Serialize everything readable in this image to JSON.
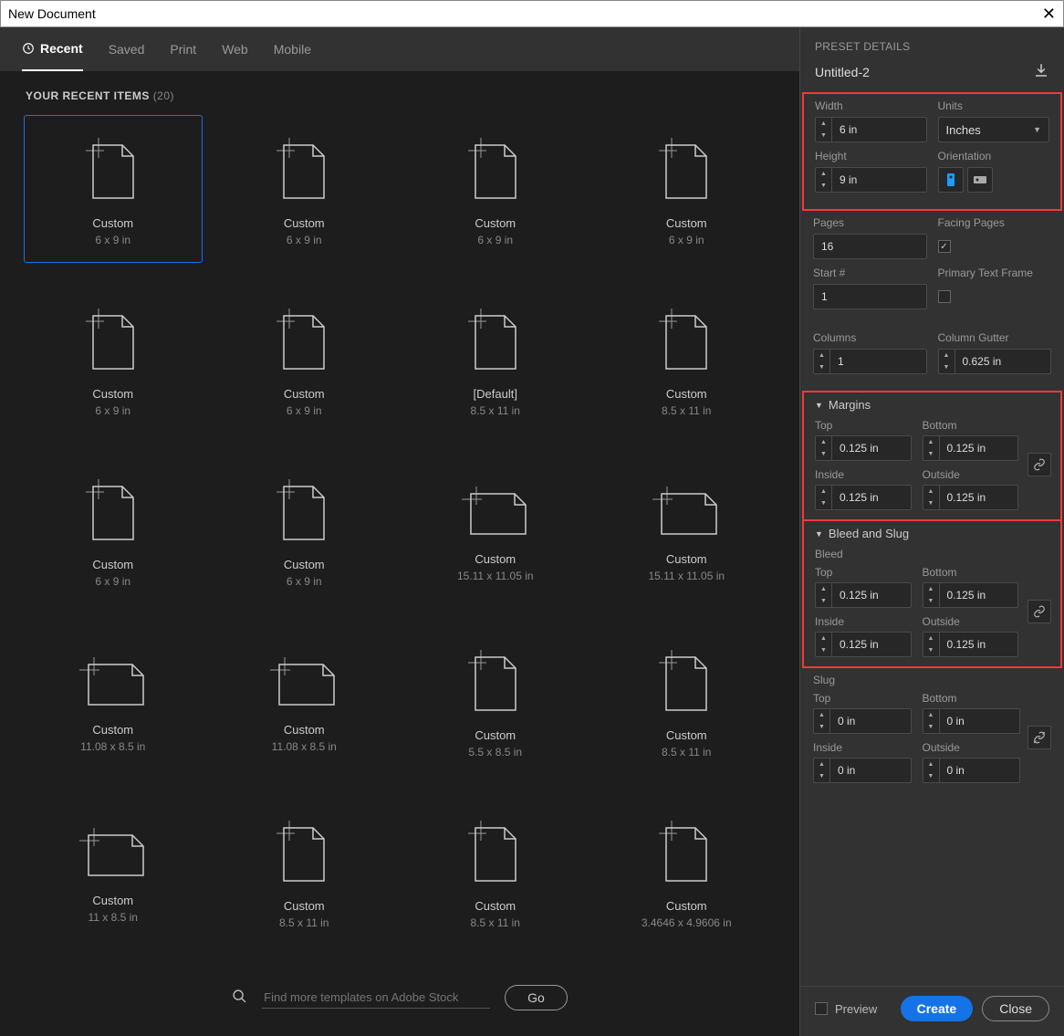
{
  "titlebar": {
    "title": "New Document"
  },
  "tabs": [
    {
      "label": "Recent",
      "active": true,
      "icon": "clock"
    },
    {
      "label": "Saved",
      "active": false
    },
    {
      "label": "Print",
      "active": false
    },
    {
      "label": "Web",
      "active": false
    },
    {
      "label": "Mobile",
      "active": false
    }
  ],
  "recent": {
    "heading": "YOUR RECENT ITEMS",
    "count": "(20)",
    "items": [
      {
        "name": "Custom",
        "dims": "6 x 9 in",
        "shape": "portrait",
        "selected": true
      },
      {
        "name": "Custom",
        "dims": "6 x 9 in",
        "shape": "portrait"
      },
      {
        "name": "Custom",
        "dims": "6 x 9 in",
        "shape": "portrait"
      },
      {
        "name": "Custom",
        "dims": "6 x 9 in",
        "shape": "portrait"
      },
      {
        "name": "Custom",
        "dims": "6 x 9 in",
        "shape": "portrait"
      },
      {
        "name": "Custom",
        "dims": "6 x 9 in",
        "shape": "portrait"
      },
      {
        "name": "[Default]",
        "dims": "8.5 x 11 in",
        "shape": "portrait"
      },
      {
        "name": "Custom",
        "dims": "8.5 x 11 in",
        "shape": "portrait"
      },
      {
        "name": "Custom",
        "dims": "6 x 9 in",
        "shape": "portrait"
      },
      {
        "name": "Custom",
        "dims": "6 x 9 in",
        "shape": "portrait"
      },
      {
        "name": "Custom",
        "dims": "15.11 x 11.05 in",
        "shape": "landscape"
      },
      {
        "name": "Custom",
        "dims": "15.11 x 11.05 in",
        "shape": "landscape"
      },
      {
        "name": "Custom",
        "dims": "11.08 x 8.5 in",
        "shape": "landscape"
      },
      {
        "name": "Custom",
        "dims": "11.08 x 8.5 in",
        "shape": "landscape"
      },
      {
        "name": "Custom",
        "dims": "5.5 x 8.5 in",
        "shape": "portrait"
      },
      {
        "name": "Custom",
        "dims": "8.5 x 11 in",
        "shape": "portrait"
      },
      {
        "name": "Custom",
        "dims": "11 x 8.5 in",
        "shape": "landscape"
      },
      {
        "name": "Custom",
        "dims": "8.5 x 11 in",
        "shape": "portrait"
      },
      {
        "name": "Custom",
        "dims": "8.5 x 11 in",
        "shape": "portrait"
      },
      {
        "name": "Custom",
        "dims": "3.4646 x 4.9606 in",
        "shape": "portrait"
      }
    ]
  },
  "search": {
    "placeholder": "Find more templates on Adobe Stock",
    "go_label": "Go"
  },
  "details": {
    "title": "PRESET DETAILS",
    "doc_name": "Untitled-2",
    "labels": {
      "width": "Width",
      "height": "Height",
      "units": "Units",
      "orientation": "Orientation",
      "pages": "Pages",
      "facing": "Facing Pages",
      "start": "Start #",
      "primary": "Primary Text Frame",
      "columns": "Columns",
      "gutter": "Column Gutter",
      "margins": "Margins",
      "top": "Top",
      "bottom": "Bottom",
      "inside": "Inside",
      "outside": "Outside",
      "bleedslug": "Bleed and Slug",
      "bleed": "Bleed",
      "slug": "Slug"
    },
    "width": "6 in",
    "height": "9 in",
    "units_value": "Inches",
    "orientation": "portrait",
    "pages": "16",
    "facing_pages": true,
    "start_num": "1",
    "primary_text_frame": false,
    "columns": "1",
    "gutter": "0.625 in",
    "margins": {
      "top": "0.125 in",
      "bottom": "0.125 in",
      "inside": "0.125 in",
      "outside": "0.125 in"
    },
    "bleed": {
      "top": "0.125 in",
      "bottom": "0.125 in",
      "inside": "0.125 in",
      "outside": "0.125 in"
    },
    "slug": {
      "top": "0 in",
      "bottom": "0 in",
      "inside": "0 in",
      "outside": "0 in"
    }
  },
  "footer": {
    "preview": "Preview",
    "create": "Create",
    "close": "Close"
  }
}
